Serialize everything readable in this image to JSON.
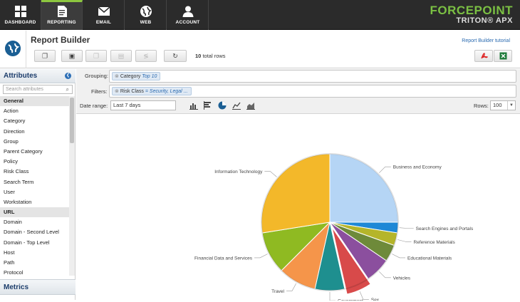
{
  "nav": {
    "items": [
      {
        "label": "DASHBOARD",
        "icon": "dashboard-icon"
      },
      {
        "label": "REPORTING",
        "icon": "report-icon"
      },
      {
        "label": "EMAIL",
        "icon": "email-icon"
      },
      {
        "label": "WEB",
        "icon": "globe-icon"
      },
      {
        "label": "ACCOUNT",
        "icon": "user-icon"
      }
    ],
    "active": "REPORTING"
  },
  "brand": {
    "line1": "FORCEPOINT",
    "line2": "TRITON® APX",
    "color": "#7bc043"
  },
  "header": {
    "title": "Report Builder",
    "total_rows_value": "10",
    "total_rows_suffix": "total rows",
    "tutorial_link": "Report Builder tutorial"
  },
  "sidebar": {
    "title": "Attributes",
    "search_placeholder": "Search attributes",
    "items": [
      {
        "label": "General",
        "group": true
      },
      {
        "label": "Action"
      },
      {
        "label": "Category"
      },
      {
        "label": "Direction"
      },
      {
        "label": "Group"
      },
      {
        "label": "Parent Category"
      },
      {
        "label": "Policy"
      },
      {
        "label": "Risk Class"
      },
      {
        "label": "Search Term"
      },
      {
        "label": "User"
      },
      {
        "label": "Workstation"
      },
      {
        "label": "URL",
        "group": true
      },
      {
        "label": "Domain"
      },
      {
        "label": "Domain - Second Level"
      },
      {
        "label": "Domain - Top Level"
      },
      {
        "label": "Host"
      },
      {
        "label": "Path"
      },
      {
        "label": "Protocol"
      }
    ],
    "metrics_title": "Metrics"
  },
  "controls": {
    "grouping_label": "Grouping:",
    "grouping_chip_name": "Category",
    "grouping_chip_value": "Top 10",
    "filters_label": "Filters:",
    "filters_chip_name": "Risk Class",
    "filters_chip_value": "= Security, Legal ...",
    "date_range_label": "Date range:",
    "date_range_value": "Last 7 days",
    "rows_label": "Rows:",
    "rows_value": "100"
  },
  "chart_data": {
    "type": "pie",
    "slices": [
      {
        "label": "Business and Economy",
        "value": 25,
        "color": "#b5d5f5"
      },
      {
        "label": "Search Engines and Portals",
        "value": 2.5,
        "color": "#1e88d6"
      },
      {
        "label": "Reference Materials",
        "value": 3,
        "color": "#b5b52a"
      },
      {
        "label": "Educational Materials",
        "value": 4,
        "color": "#6e8a3a"
      },
      {
        "label": "Vehicles",
        "value": 6,
        "color": "#8b4f9e"
      },
      {
        "label": "Sex",
        "value": 6,
        "color": "#d84a4a"
      },
      {
        "label": "Government",
        "value": 7,
        "color": "#1e8f8f"
      },
      {
        "label": "Travel",
        "value": 9,
        "color": "#f5954a"
      },
      {
        "label": "Financial Data and Services",
        "value": 10,
        "color": "#8fba22"
      },
      {
        "label": "Information Technology",
        "value": 27.5,
        "color": "#f3b82a"
      }
    ]
  }
}
